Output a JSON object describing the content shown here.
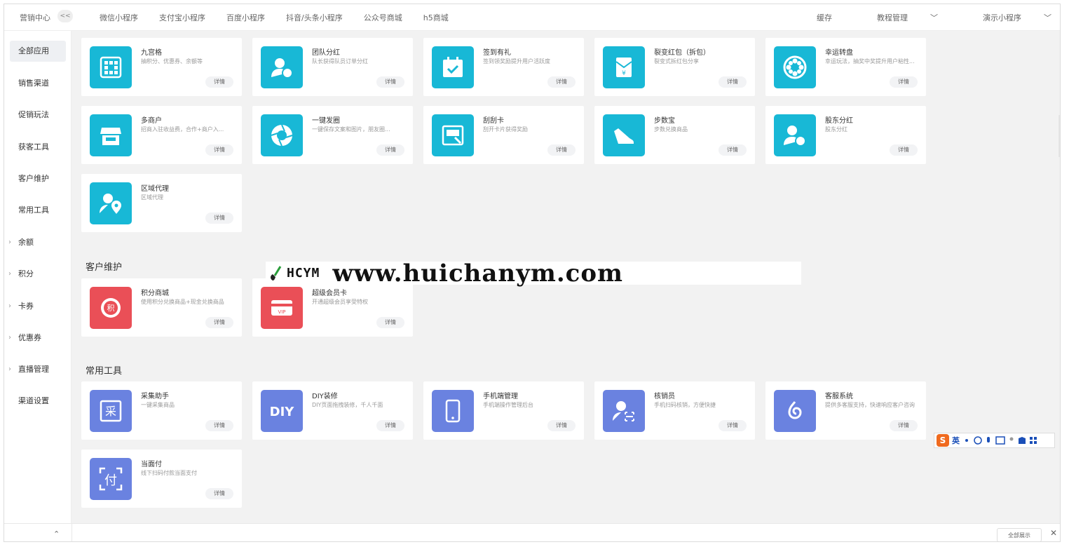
{
  "topnav": {
    "brand": "营销中心",
    "collapse": "<<",
    "tabs": [
      "微信小程序",
      "支付宝小程序",
      "百度小程序",
      "抖音/头条小程序",
      "公众号商城",
      "h5商城"
    ],
    "right": {
      "cache": "缓存",
      "tutorial": "教程管理",
      "demo": "演示小程序"
    }
  },
  "sidebar": {
    "items": [
      "全部应用",
      "销售渠道",
      "促销玩法",
      "获客工具",
      "客户维护",
      "常用工具",
      "余额",
      "积分",
      "卡券",
      "优惠券",
      "直播管理",
      "渠道设置"
    ]
  },
  "sections": {
    "customer": "客户维护",
    "tools": "常用工具"
  },
  "cards": {
    "detail_label": "详情",
    "sales": [
      {
        "name": "九宫格",
        "desc": "抽积分、优惠券、余额等"
      },
      {
        "name": "团队分红",
        "desc": "队长获得队员订单分红"
      },
      {
        "name": "签到有礼",
        "desc": "签到领奖励提升用户活跃度"
      },
      {
        "name": "裂变红包（拆包）",
        "desc": "裂变式拆红包分享"
      },
      {
        "name": "幸运转盘",
        "desc": "幸运玩法，抽奖中奖提升用户粘性..."
      },
      {
        "name": "多商户",
        "desc": "招商入驻收益费，合作+商户入..."
      },
      {
        "name": "一键发圈",
        "desc": "一键保存文案和图片，朋友圈..."
      },
      {
        "name": "刮刮卡",
        "desc": "刮开卡片获得奖励"
      },
      {
        "name": "步数宝",
        "desc": "步数兑换商品"
      },
      {
        "name": "股东分红",
        "desc": "股东分红"
      },
      {
        "name": "区域代理",
        "desc": "区域代理"
      }
    ],
    "customer": [
      {
        "name": "积分商城",
        "desc": "使用积分兑换商品+现金兑换商品"
      },
      {
        "name": "超级会员卡",
        "desc": "开通超级会员享受特权"
      }
    ],
    "tools": [
      {
        "name": "采集助手",
        "desc": "一键采集商品"
      },
      {
        "name": "DIY装修",
        "desc": "DIY页面拖拽装修，千人千面"
      },
      {
        "name": "手机端管理",
        "desc": "手机端操作管理后台"
      },
      {
        "name": "核销员",
        "desc": "手机扫码核销，方便快捷"
      },
      {
        "name": "客服系统",
        "desc": "提供多客服支持，快速响应客户咨询"
      },
      {
        "name": "当面付",
        "desc": "线下扫码付款当面支付"
      }
    ]
  },
  "watermark": {
    "logo": "HCYM",
    "url": "www.huichanym.com"
  },
  "ime": {
    "s": "S",
    "lang": "英"
  },
  "bottom": {
    "restore": "全部展示",
    "close": "✕",
    "caret": "⌃"
  },
  "colors": {
    "teal": "#18b8d6",
    "red": "#ea4f57",
    "purple": "#6a82e0"
  }
}
